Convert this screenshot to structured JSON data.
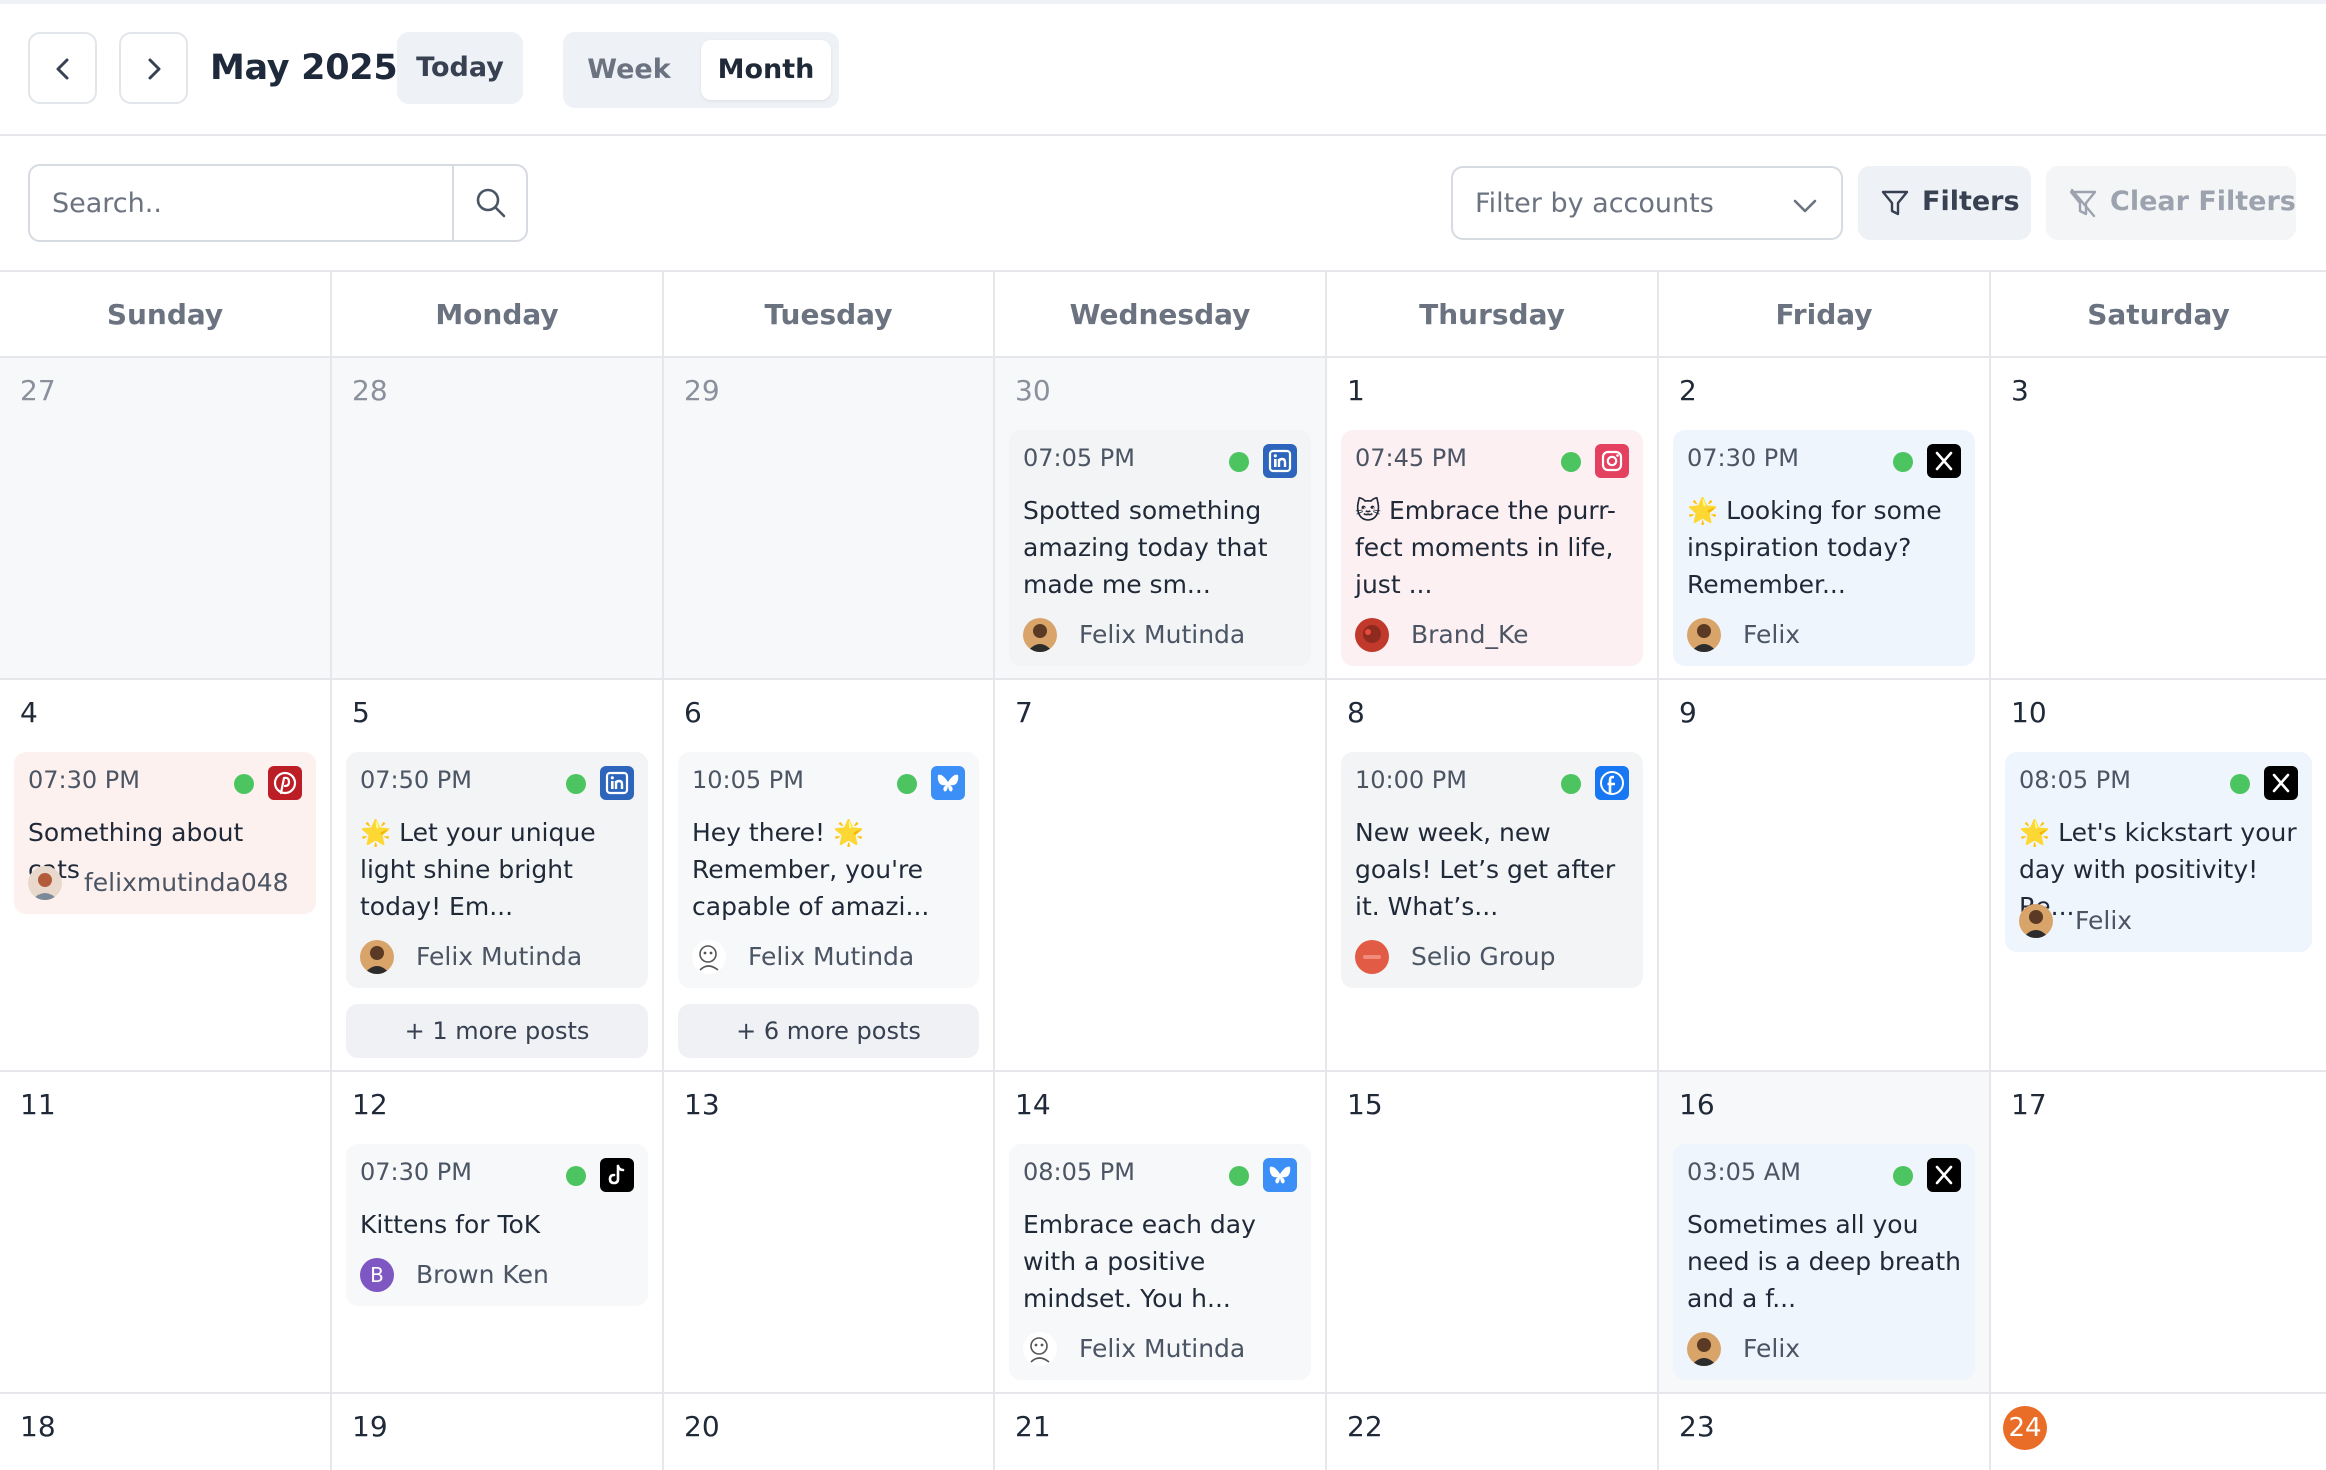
{
  "header": {
    "month_title": "May 2025",
    "today_label": "Today",
    "views": {
      "week": "Week",
      "month": "Month"
    },
    "active_view": "Month"
  },
  "toolbar": {
    "search_placeholder": "Search..",
    "account_filter_placeholder": "Filter by accounts",
    "filters_label": "Filters",
    "clear_filters_label": "Clear Filters"
  },
  "weekdays": [
    "Sunday",
    "Monday",
    "Tuesday",
    "Wednesday",
    "Thursday",
    "Friday",
    "Saturday"
  ],
  "colors": {
    "status_dot": "#4cc460",
    "today_badge": "#ea6d27",
    "linkedin": "#2d64bc",
    "instagram": "#e4405f",
    "pinterest": "#bd1d24",
    "bluesky": "#3b8ff6",
    "facebook": "#1877f2"
  },
  "weeks": {
    "w1": {
      "days": [
        "27",
        "28",
        "29",
        "30",
        "1",
        "2",
        "3"
      ],
      "wed": {
        "time": "07:05 PM",
        "network": "linkedin-icon",
        "text": "Spotted something amazing today that made me sm...",
        "author": "Felix Mutinda"
      },
      "thu": {
        "time": "07:45 PM",
        "network": "instagram-icon",
        "text": "🐱 Embrace the purr-fect moments in life, just ...",
        "author": "Brand_Ke"
      },
      "fri": {
        "time": "07:30 PM",
        "network": "x-icon",
        "text": "🌟 Looking for some inspiration today? Remember...",
        "author": "Felix"
      }
    },
    "w2": {
      "days": [
        "4",
        "5",
        "6",
        "7",
        "8",
        "9",
        "10"
      ],
      "sun": {
        "time": "07:30 PM",
        "network": "pinterest-icon",
        "text": "Something about cats",
        "author": "felixmutinda048"
      },
      "mon": {
        "time": "07:50 PM",
        "network": "linkedin-icon",
        "text": "🌟 Let your unique light shine bright today! Em...",
        "author": "Felix Mutinda",
        "more": "+ 1 more posts"
      },
      "tue": {
        "time": "10:05 PM",
        "network": "bluesky-icon",
        "text": "Hey there! 🌟 Remember, you're capable of amazi...",
        "author": "Felix Mutinda",
        "more": "+ 6 more posts"
      },
      "thu": {
        "time": "10:00 PM",
        "network": "facebook-icon",
        "text": "New week, new goals! Let’s get after it. What’s...",
        "author": "Selio Group"
      },
      "sat": {
        "time": "08:05 PM",
        "network": "x-icon",
        "text": "🌟 Let's kickstart your day with positivity! Re...",
        "author": "Felix"
      }
    },
    "w3": {
      "days": [
        "11",
        "12",
        "13",
        "14",
        "15",
        "16",
        "17"
      ],
      "mon": {
        "time": "07:30 PM",
        "network": "tiktok-icon",
        "text": "Kittens for ToK",
        "author": "Brown Ken",
        "avatar_letter": "B"
      },
      "wed": {
        "time": "08:05 PM",
        "network": "bluesky-icon",
        "text": "Embrace each day with a positive mindset. You h...",
        "author": "Felix Mutinda"
      },
      "fri": {
        "time": "03:05 AM",
        "network": "x-icon",
        "text": "Sometimes all you need is a deep breath and a f...",
        "author": "Felix"
      }
    },
    "w4": {
      "days": [
        "18",
        "19",
        "20",
        "21",
        "22",
        "23",
        "24"
      ],
      "today": "24"
    }
  }
}
